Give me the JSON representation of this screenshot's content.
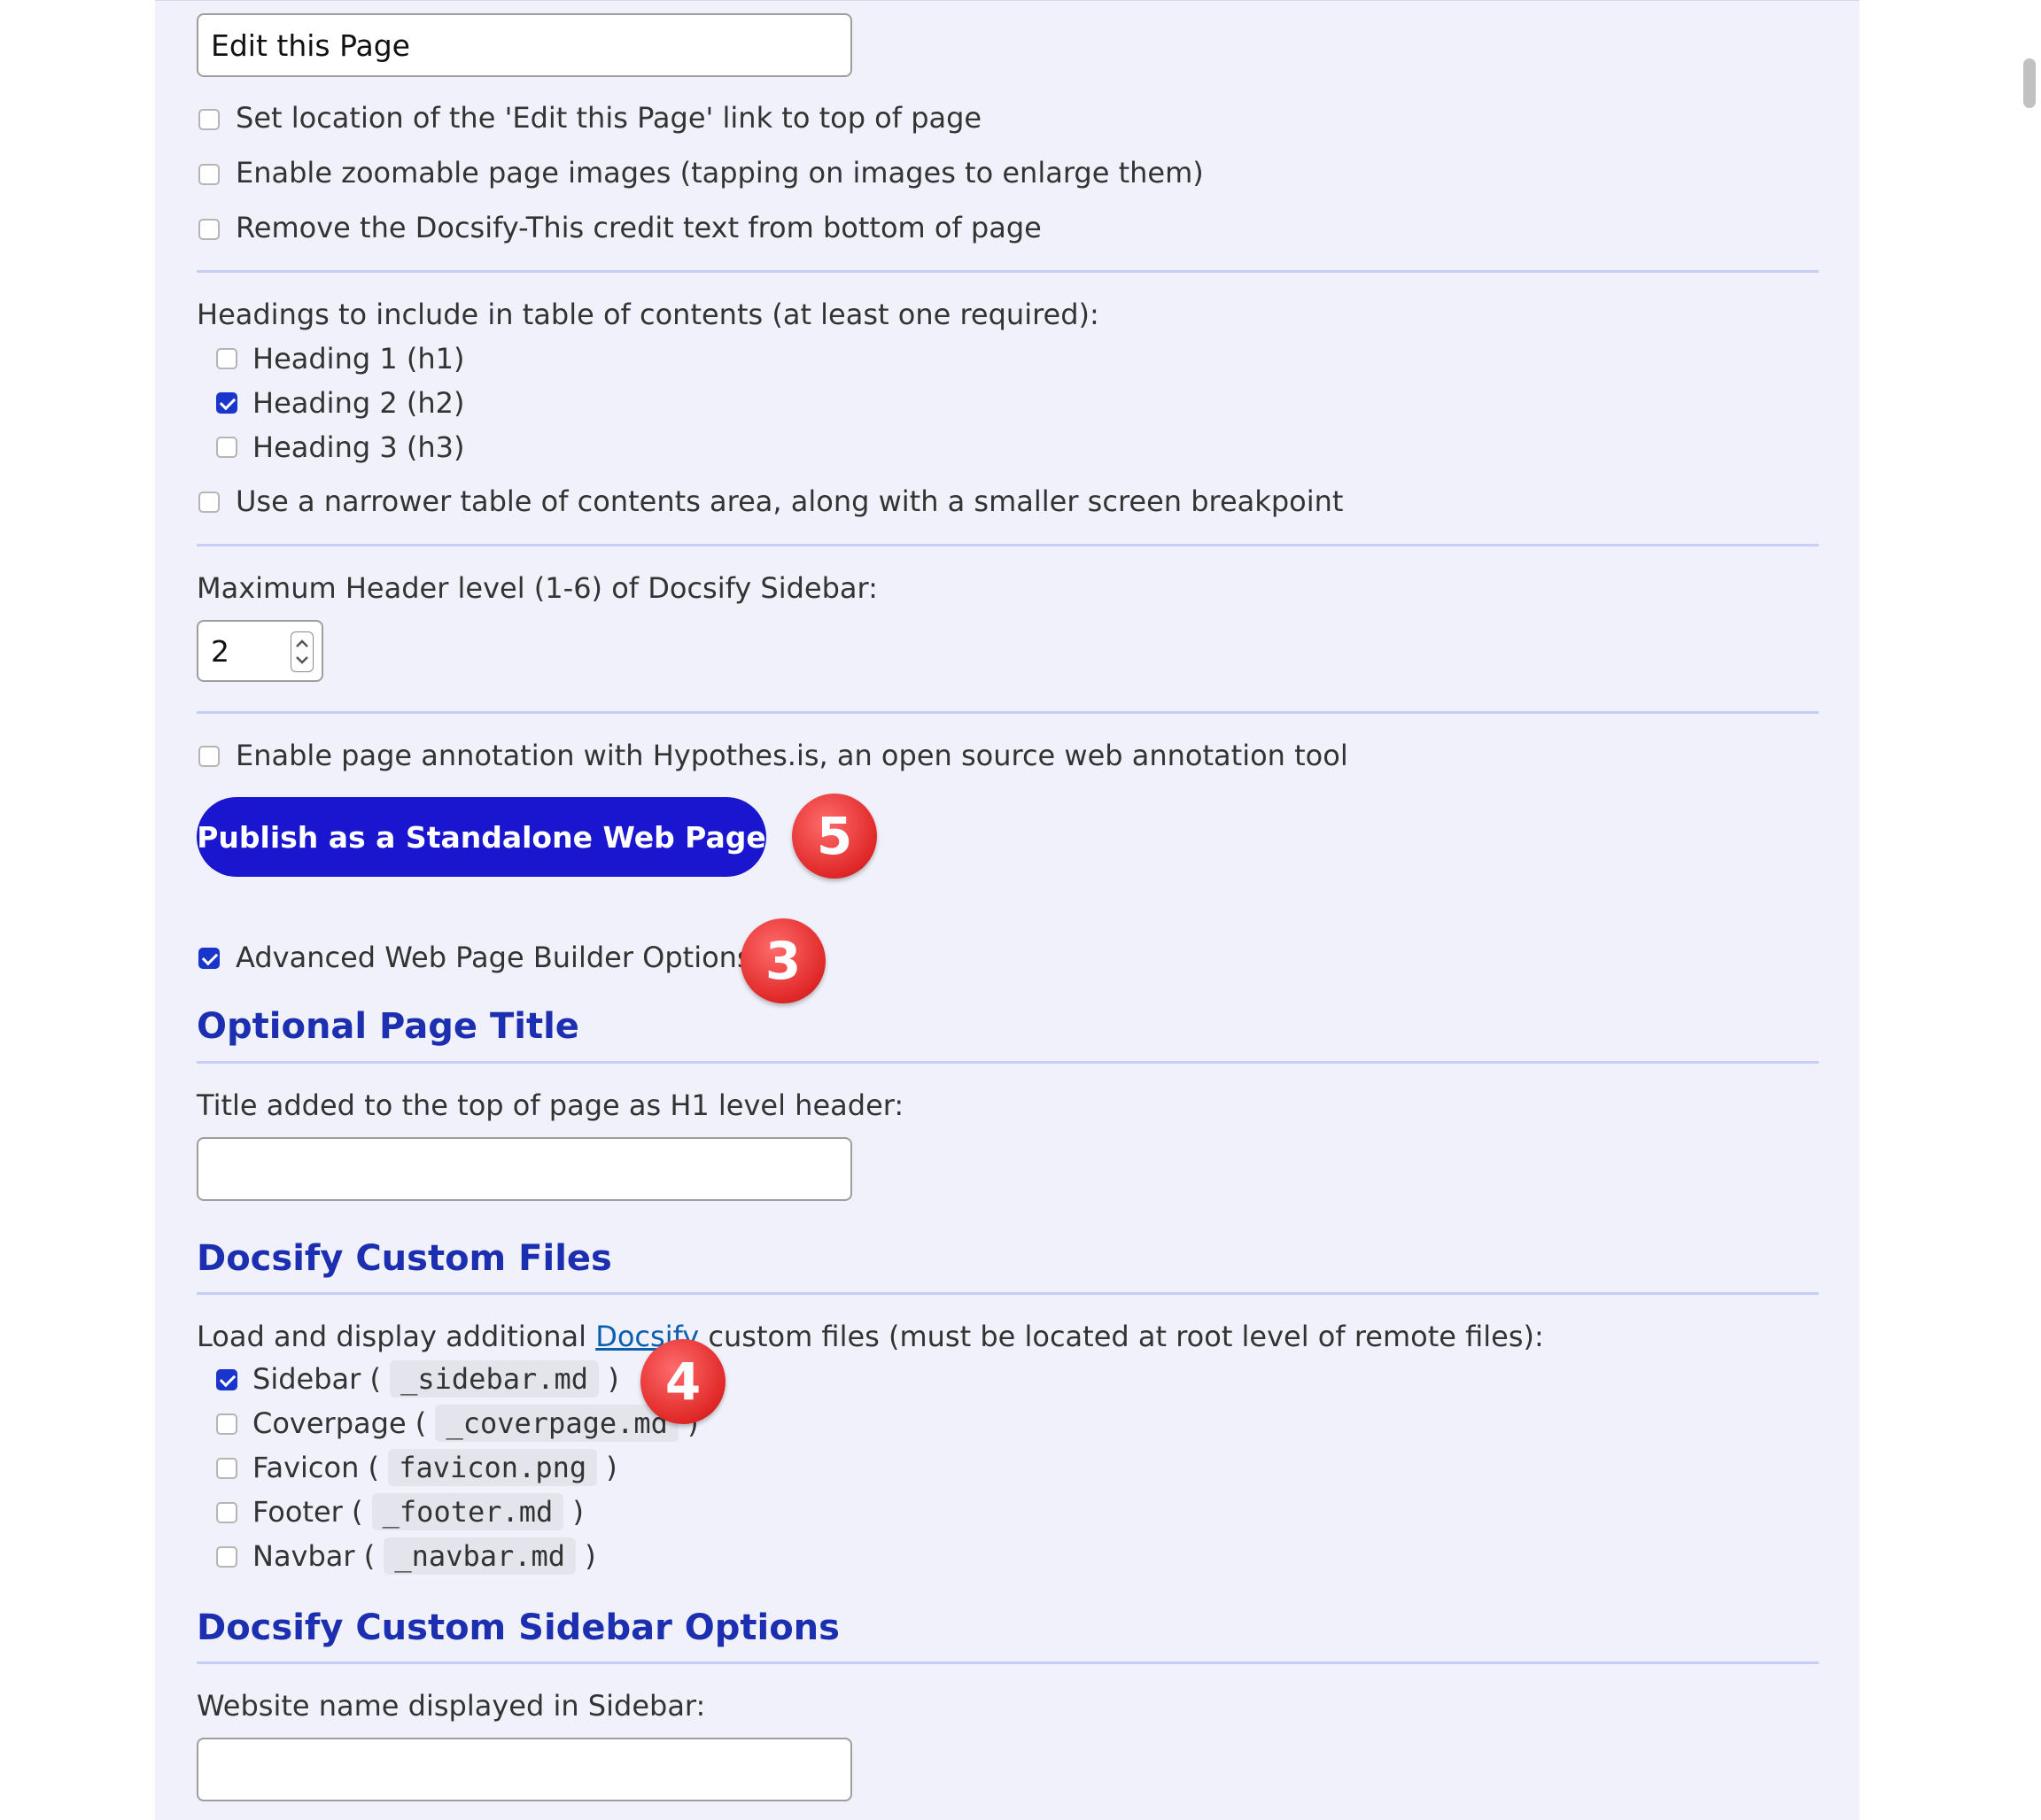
{
  "edit_link": {
    "value": "Edit this Page"
  },
  "options_top": [
    {
      "label": "Set location of the 'Edit this Page' link to top of page",
      "checked": false
    },
    {
      "label": "Enable zoomable page images (tapping on images to enlarge them)",
      "checked": false
    },
    {
      "label": "Remove the Docsify-This credit text from bottom of page",
      "checked": false
    }
  ],
  "toc": {
    "label": "Headings to include in table of contents (at least one required):",
    "headings": [
      {
        "label": "Heading 1 (h1)",
        "checked": false
      },
      {
        "label": "Heading 2 (h2)",
        "checked": true
      },
      {
        "label": "Heading 3 (h3)",
        "checked": false
      }
    ],
    "narrow_label": "Use a narrower table of contents area, along with a smaller screen breakpoint"
  },
  "sidebar_level": {
    "label": "Maximum Header level (1-6) of Docsify Sidebar:",
    "value": "2"
  },
  "hypothesis": {
    "label": "Enable page annotation with Hypothes.is, an open source web annotation tool",
    "checked": false
  },
  "publish_button": {
    "label": "Publish as a Standalone Web Page"
  },
  "advanced": {
    "label": "Advanced Web Page Builder Options",
    "checked": true
  },
  "badges": {
    "publish": "5",
    "advanced": "3",
    "sidebar": "4"
  },
  "page_title": {
    "heading": "Optional Page Title",
    "label": "Title added to the top of page as H1 level header:",
    "value": ""
  },
  "custom_files": {
    "heading": "Docsify Custom Files",
    "intro_before": "Load and display additional ",
    "intro_link": "Docsify",
    "intro_after": " custom files (must be located at root level of remote files):",
    "files": [
      {
        "label": "Sidebar (",
        "file": "_sidebar.md",
        "close": ")",
        "checked": true
      },
      {
        "label": "Coverpage (",
        "file": "_coverpage.md",
        "close": ")",
        "checked": false
      },
      {
        "label": "Favicon (",
        "file": "favicon.png",
        "close": ")",
        "checked": false
      },
      {
        "label": "Footer (",
        "file": "_footer.md",
        "close": ")",
        "checked": false
      },
      {
        "label": "Navbar (",
        "file": "_navbar.md",
        "close": ")",
        "checked": false
      }
    ]
  },
  "sidebar_options": {
    "heading": "Docsify Custom Sidebar Options",
    "name_label": "Website name displayed in Sidebar:",
    "name_value": ""
  },
  "colors": {
    "accent": "#1a16cf",
    "heading": "#1c2fb0",
    "panel": "#f0f1fa",
    "badge": "#e02828"
  }
}
